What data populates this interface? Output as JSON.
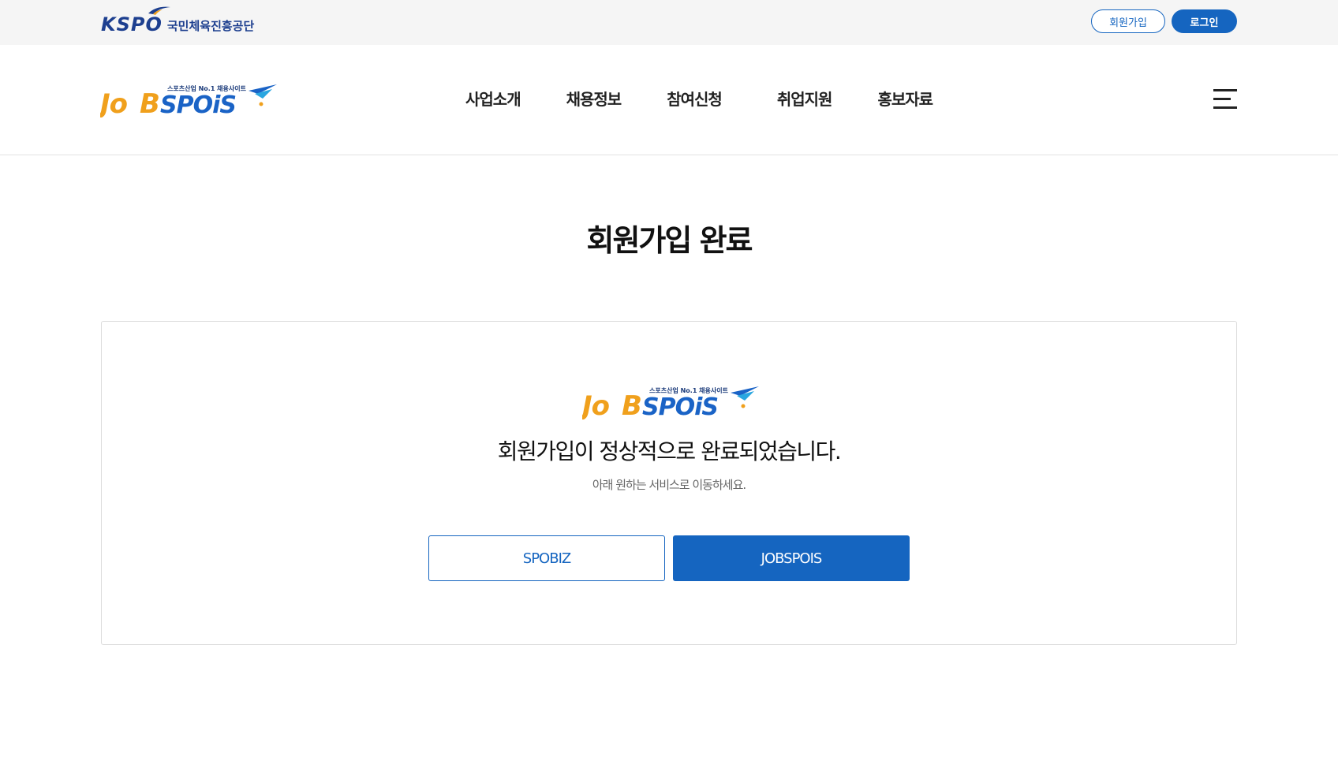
{
  "topbar": {
    "kspo_mark": "KSPO",
    "kspo_name": "국민체육진흥공단",
    "join_label": "회원가입",
    "login_label": "로그인"
  },
  "brand": {
    "logo_jo": "Jo",
    "logo_b": "B",
    "logo_spois": "SPOiS",
    "tagline": "스포츠산업 No.1 채용사이트"
  },
  "nav": {
    "items": [
      {
        "label": "사업소개"
      },
      {
        "label": "채용정보"
      },
      {
        "label": "참여신청"
      },
      {
        "label": "취업지원"
      },
      {
        "label": "홍보자료"
      }
    ]
  },
  "page": {
    "title": "회원가입 완료"
  },
  "card": {
    "message": "회원가입이 정상적으로 완료되었습니다.",
    "sub_message": "아래 원하는 서비스로 이동하세요.",
    "spobiz_label": "SPOBIZ",
    "jobspois_label": "JOBSPOIS"
  },
  "colors": {
    "primary": "#1565c0",
    "kspo_navy": "#1d3f8f",
    "logo_orange": "#f0a01c",
    "logo_blue": "#1a63c6",
    "logo_cyan": "#29a6e0"
  }
}
